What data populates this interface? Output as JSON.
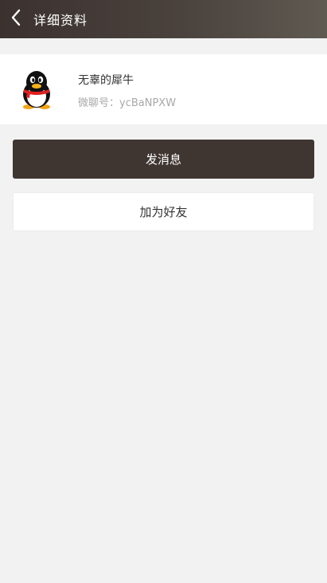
{
  "header": {
    "title": "详细资料",
    "back_icon": "chevron-left-icon"
  },
  "profile": {
    "nickname": "无辜的犀牛",
    "wechat_id": "微聊号：ycBaNPXW",
    "avatar_icon": "penguin-avatar"
  },
  "actions": {
    "send_message_label": "发消息",
    "add_friend_label": "加为好友"
  },
  "colors": {
    "header_dark": "#3b3230",
    "primary_button": "#3f3632",
    "background": "#f2f2f2"
  }
}
